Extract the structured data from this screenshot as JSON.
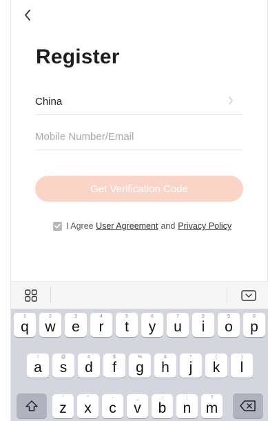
{
  "header": {
    "back_icon": "chevron-left-icon",
    "title": "Register"
  },
  "form": {
    "country_label": "China",
    "contact_placeholder": "Mobile Number/Email",
    "contact_value": "",
    "verify_button": "Get Verification Code",
    "verify_button_color": "#fbd4c8"
  },
  "agreement": {
    "checked": true,
    "prefix": "I Agree",
    "user_agreement": "User Agreement",
    "and": "and",
    "privacy_policy": "Privacy Policy"
  },
  "keyboard": {
    "toolbar": {
      "left_icon": "grid-icon",
      "right_icon": "keyboard-hide-icon"
    },
    "row1": [
      {
        "ch": "q",
        "hint": "1"
      },
      {
        "ch": "w",
        "hint": "2"
      },
      {
        "ch": "e",
        "hint": "3"
      },
      {
        "ch": "r",
        "hint": "4"
      },
      {
        "ch": "t",
        "hint": "5"
      },
      {
        "ch": "y",
        "hint": "6"
      },
      {
        "ch": "u",
        "hint": "7"
      },
      {
        "ch": "i",
        "hint": "8"
      },
      {
        "ch": "o",
        "hint": "9"
      },
      {
        "ch": "p",
        "hint": "0"
      }
    ],
    "row2": [
      {
        "ch": "a",
        "hint": "!"
      },
      {
        "ch": "s",
        "hint": "@"
      },
      {
        "ch": "d",
        "hint": "#"
      },
      {
        "ch": "f",
        "hint": "$"
      },
      {
        "ch": "g",
        "hint": "%"
      },
      {
        "ch": "h",
        "hint": "&"
      },
      {
        "ch": "j",
        "hint": "*"
      },
      {
        "ch": "k",
        "hint": "("
      },
      {
        "ch": "l",
        "hint": ")"
      }
    ],
    "row3": [
      {
        "ch": "z",
        "hint": "'"
      },
      {
        "ch": "x",
        "hint": "\""
      },
      {
        "ch": "c",
        "hint": "-"
      },
      {
        "ch": "v",
        "hint": "_"
      },
      {
        "ch": "b",
        "hint": ":"
      },
      {
        "ch": "n",
        "hint": ";"
      },
      {
        "ch": "m",
        "hint": "?"
      }
    ],
    "shift_icon": "shift-icon",
    "delete_icon": "backspace-icon",
    "colors": {
      "background": "#d3d6dd",
      "key": "#ffffff",
      "function_key": "#aeb3bd"
    }
  }
}
